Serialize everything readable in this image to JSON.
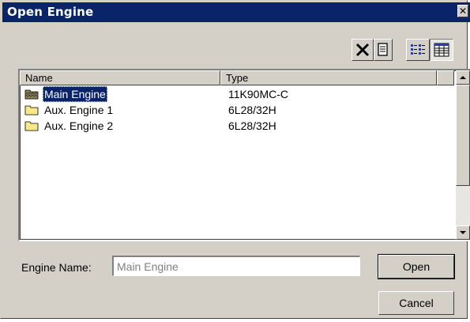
{
  "window": {
    "title": "Open Engine",
    "close_glyph": "✕"
  },
  "toolbar": {
    "buttons": [
      {
        "icon": "delete-icon"
      },
      {
        "icon": "properties-icon"
      },
      {
        "icon": "list-view-icon"
      },
      {
        "icon": "details-view-icon",
        "pressed": true
      }
    ]
  },
  "list": {
    "columns": [
      "Name",
      "Type"
    ],
    "rows": [
      {
        "name": "Main Engine",
        "type": "11K90MC-C",
        "icon": "engine-folder-icon",
        "selected": true
      },
      {
        "name": "Aux. Engine 1",
        "type": "6L28/32H",
        "icon": "folder-icon",
        "selected": false
      },
      {
        "name": "Aux. Engine 2",
        "type": "6L28/32H",
        "icon": "folder-icon",
        "selected": false
      }
    ]
  },
  "form": {
    "engine_name_label": "Engine Name:",
    "engine_name_value": "Main Engine"
  },
  "buttons": {
    "open": "Open",
    "cancel": "Cancel"
  },
  "colors": {
    "titlebar": "#0a246a",
    "face": "#d4d0c8",
    "selection": "#0a246a"
  }
}
